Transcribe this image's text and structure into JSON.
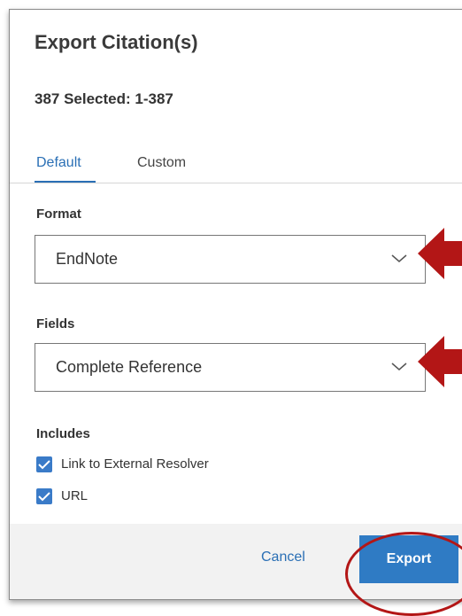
{
  "dialog": {
    "title": "Export Citation(s)",
    "selected": "387 Selected: 1-387"
  },
  "tabs": [
    {
      "label": "Default",
      "active": true
    },
    {
      "label": "Custom",
      "active": false
    }
  ],
  "format": {
    "label": "Format",
    "value": "EndNote"
  },
  "fields": {
    "label": "Fields",
    "value": "Complete Reference"
  },
  "includes": {
    "label": "Includes",
    "options": [
      {
        "label": "Link to External Resolver",
        "checked": true
      },
      {
        "label": "URL",
        "checked": true
      }
    ]
  },
  "footer": {
    "cancel_label": "Cancel",
    "export_label": "Export"
  },
  "colors": {
    "accent": "#2f7bc4",
    "annotation": "#b31616",
    "footer_bg": "#f2f2f2"
  },
  "icons": {
    "dropdown": "chevron-down-icon",
    "checkbox": "checkmark-icon",
    "annotation": "red-arrow-icon"
  }
}
